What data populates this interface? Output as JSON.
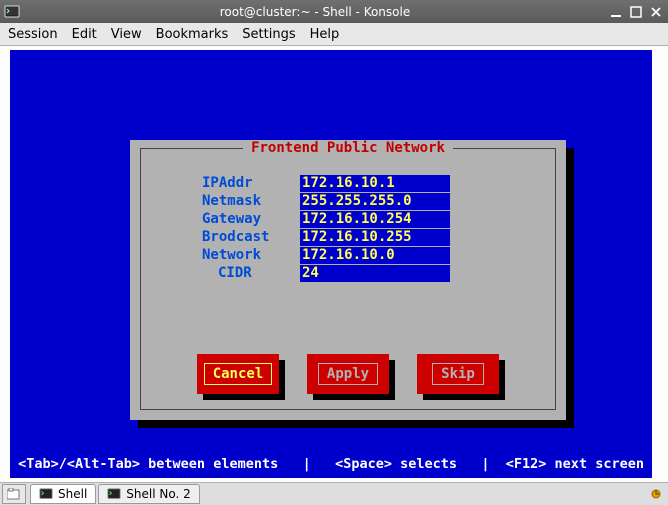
{
  "window": {
    "title": "root@cluster:~ - Shell - Konsole"
  },
  "menu": {
    "items": [
      "Session",
      "Edit",
      "View",
      "Bookmarks",
      "Settings",
      "Help"
    ]
  },
  "dialog": {
    "title": "Frontend Public Network",
    "fields": [
      {
        "label": "IPAddr",
        "value": "172.16.10.1"
      },
      {
        "label": "Netmask",
        "value": "255.255.255.0"
      },
      {
        "label": "Gateway",
        "value": "172.16.10.254"
      },
      {
        "label": "Brodcast",
        "value": "172.16.10.255"
      },
      {
        "label": "Network",
        "value": "172.16.10.0"
      },
      {
        "label": "CIDR",
        "value": "24"
      }
    ],
    "buttons": {
      "cancel": "Cancel",
      "apply": "Apply",
      "skip": "Skip"
    }
  },
  "hint": " <Tab>/<Alt-Tab> between elements   |   <Space> selects   |  <F12> next screen ",
  "tabs": {
    "tab1": "Shell",
    "tab2": "Shell No. 2"
  }
}
